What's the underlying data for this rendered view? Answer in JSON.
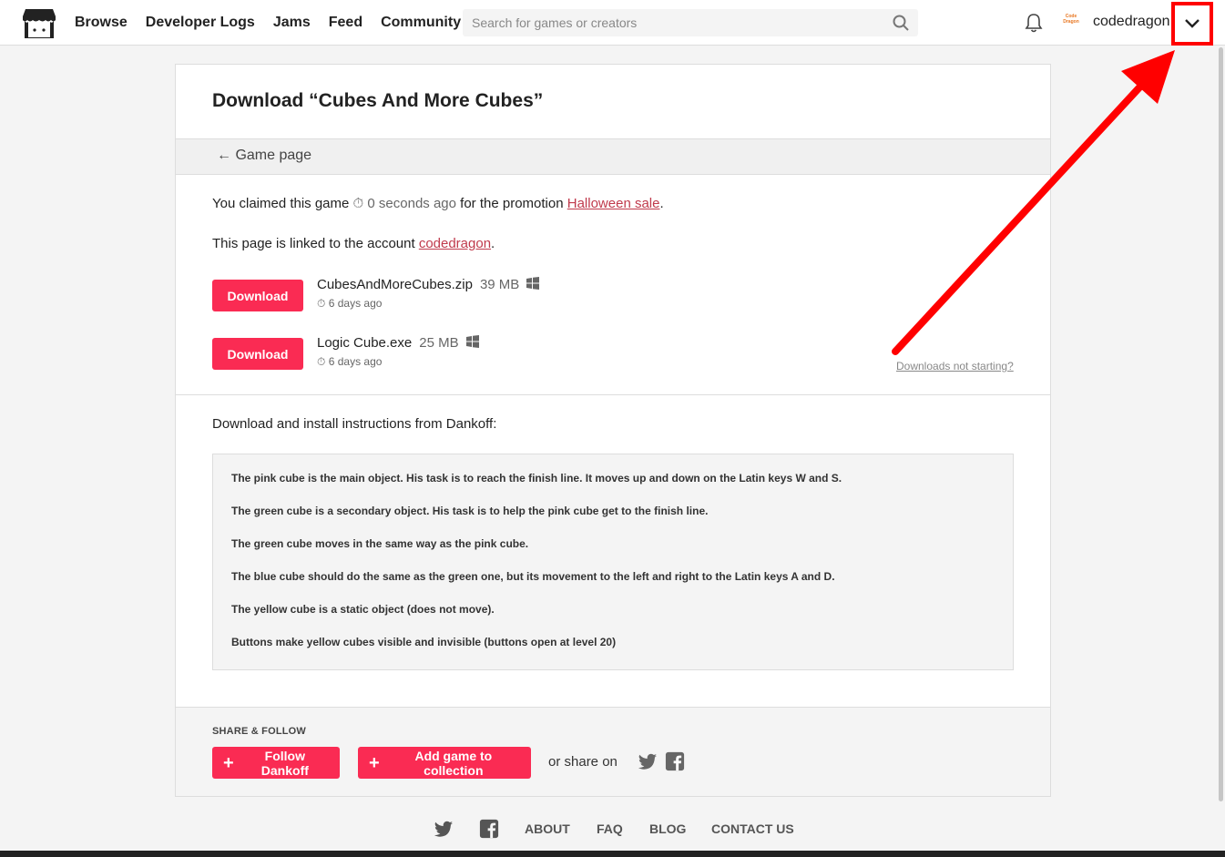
{
  "header": {
    "nav": [
      "Browse",
      "Developer Logs",
      "Jams",
      "Feed",
      "Community"
    ],
    "search_placeholder": "Search for games or creators",
    "avatar_text": "Code Dragon",
    "username": "codedragon"
  },
  "card": {
    "title_prefix": "Download “",
    "title_game": "Cubes And More Cubes",
    "title_suffix": "”",
    "back_link": "Game page",
    "claimed_text": "You claimed this game",
    "claimed_time": "0 seconds ago",
    "claimed_middle": "for the promotion",
    "promotion": "Halloween sale",
    "linked_text": "This page is linked to the account",
    "linked_account": "codedragon",
    "downloads": [
      {
        "button": "Download",
        "name": "CubesAndMoreCubes.zip",
        "size": "39 MB",
        "date": "6 days ago"
      },
      {
        "button": "Download",
        "name": "Logic Cube.exe",
        "size": "25 MB",
        "date": "6 days ago"
      }
    ],
    "not_starting": "Downloads not starting?",
    "instructions_title": "Download and install instructions from Dankoff:",
    "instructions": [
      "The pink cube is the main object. His task is to reach the finish line. It moves up and down on the Latin keys W and S.",
      "The green cube is a secondary object. His task is to help the pink cube get to the finish line.",
      "The green cube moves in the same way as the pink cube.",
      "The blue cube should do the same as the green one, but its movement to the left and right to the Latin keys A and D.",
      "The yellow cube is a static object (does not move).",
      "Buttons make yellow cubes visible and invisible (buttons open at level 20)"
    ],
    "share_label": "SHARE & FOLLOW",
    "follow_button": "Follow Dankoff",
    "collection_button": "Add game to collection",
    "share_on": "or share on"
  },
  "footer": {
    "links": [
      "ABOUT",
      "FAQ",
      "BLOG",
      "CONTACT US"
    ]
  },
  "colors": {
    "accent": "#fa2b53",
    "link": "#c03a4c",
    "annotation": "#ff0000"
  }
}
